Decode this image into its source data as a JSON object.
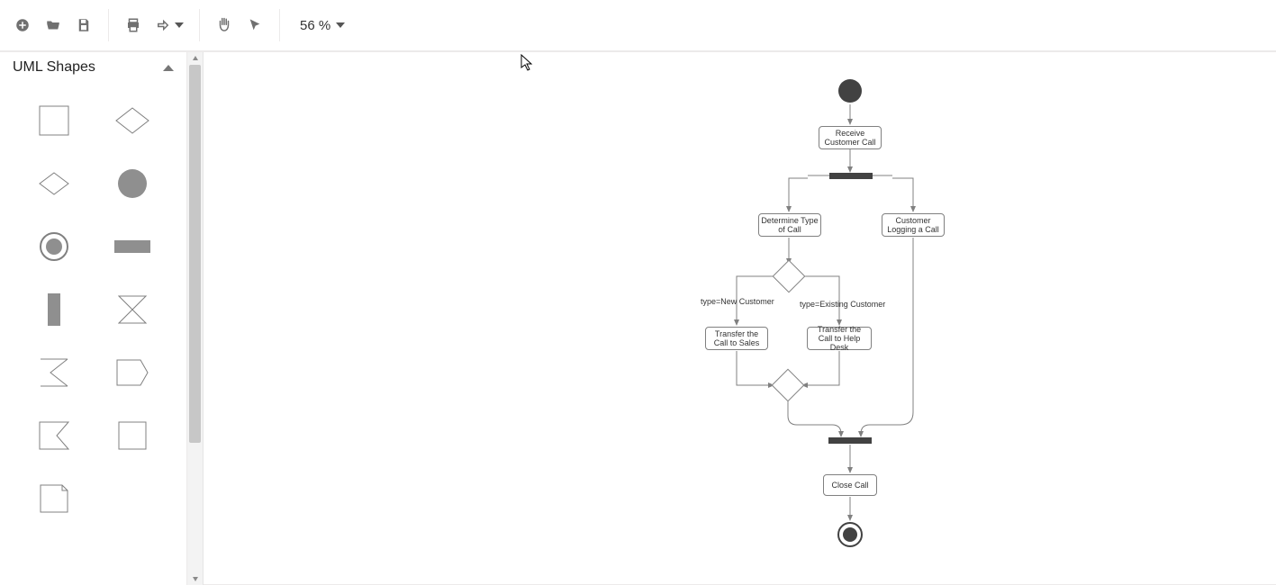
{
  "toolbar": {
    "zoom_label": "56 %"
  },
  "sidebar": {
    "title": "UML Shapes"
  },
  "diagram": {
    "nodes": {
      "receive": "Receive Customer Call",
      "determine": "Determine Type of Call",
      "logging": "Customer Logging a Call",
      "sales": "Transfer the Call to Sales",
      "helpdesk": "Transfer the Call to Help Desk",
      "close": "Close Call"
    },
    "edges": {
      "new": "type=New Customer",
      "existing": "type=Existing Customer"
    }
  }
}
